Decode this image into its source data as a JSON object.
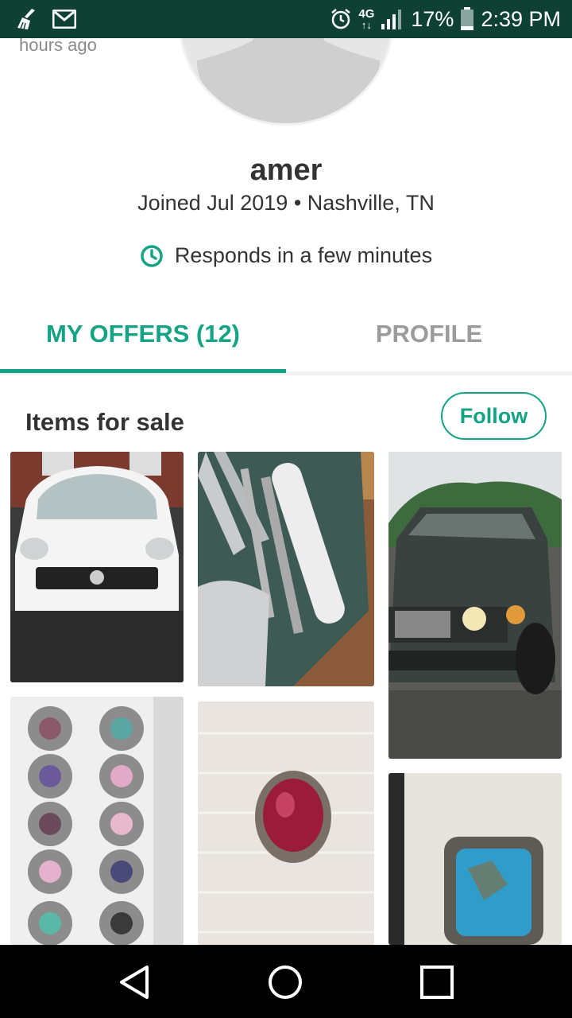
{
  "status_bar": {
    "network": "4G",
    "battery": "17%",
    "time": "2:39 PM",
    "icons": [
      "broom-icon",
      "gmail-icon",
      "alarm-icon",
      "lte-icon",
      "signal-icon",
      "battery-icon"
    ]
  },
  "profile": {
    "hours_ago": "hours ago",
    "username": "amer",
    "joined": "Joined Jul 2019 • Nashville, TN",
    "responds": "Responds in a few minutes"
  },
  "tabs": [
    {
      "label": "MY OFFERS (12)",
      "active": true
    },
    {
      "label": "PROFILE",
      "active": false
    }
  ],
  "items": {
    "title": "Items for sale",
    "follow_label": "Follow",
    "photos": [
      "white-minivan",
      "metal-parts",
      "gray-suv",
      "gemstone-rings-tray",
      "red-stone-ring",
      "turquoise-ring"
    ]
  },
  "colors": {
    "accent": "#14a384",
    "status_bar": "#0e4034",
    "nav_bar": "#000000"
  }
}
